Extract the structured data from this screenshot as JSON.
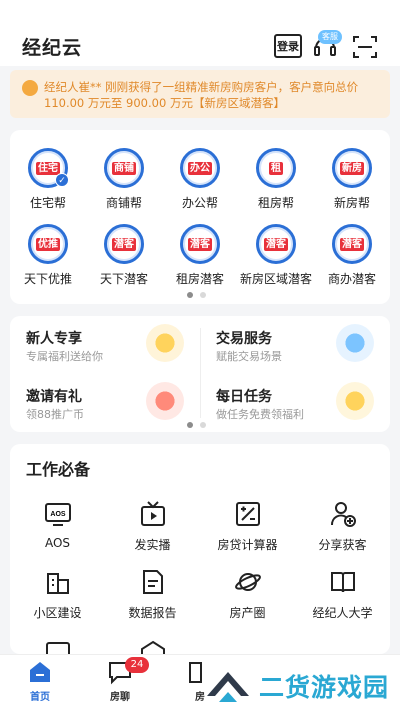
{
  "header": {
    "title": "经纪云",
    "login_label": "登录",
    "cs_badge": "客服",
    "icons": [
      "login-icon",
      "customer-service-icon",
      "scan-icon"
    ]
  },
  "notice": {
    "text_main": "经纪人崔** 刚刚获得了一组精准新房购房客户，客户意向总价 110.00 万元至 900.00 万元",
    "text_tag": "【新房区域潜客】"
  },
  "grid1": {
    "items": [
      {
        "logo": "住宅",
        "label": "住宅帮"
      },
      {
        "logo": "商铺",
        "label": "商铺帮"
      },
      {
        "logo": "办公",
        "label": "办公帮"
      },
      {
        "logo": "租",
        "label": "租房帮"
      },
      {
        "logo": "新房",
        "label": "新房帮"
      },
      {
        "logo": "优推",
        "label": "天下优推"
      },
      {
        "logo": "潜客",
        "label": "天下潜客"
      },
      {
        "logo": "潜客",
        "label": "租房潜客"
      },
      {
        "logo": "潜客",
        "label": "新房区域潜客"
      },
      {
        "logo": "潜客",
        "label": "商办潜客"
      }
    ]
  },
  "promo": {
    "items": [
      {
        "title": "新人专享",
        "sub": "专属福利送给你"
      },
      {
        "title": "交易服务",
        "sub": "赋能交易场景"
      },
      {
        "title": "邀请有礼",
        "sub": "领88推广币"
      },
      {
        "title": "每日任务",
        "sub": "做任务免费领福利"
      }
    ]
  },
  "work": {
    "title": "工作必备",
    "items": [
      {
        "label": "AOS",
        "icon": "aos-icon"
      },
      {
        "label": "发实播",
        "icon": "live-icon"
      },
      {
        "label": "房贷计算器",
        "icon": "calculator-icon"
      },
      {
        "label": "分享获客",
        "icon": "share-user-icon"
      },
      {
        "label": "小区建设",
        "icon": "building-icon"
      },
      {
        "label": "数据报告",
        "icon": "report-icon"
      },
      {
        "label": "房产圈",
        "icon": "planet-icon"
      },
      {
        "label": "经纪人大学",
        "icon": "book-icon"
      }
    ]
  },
  "tabbar": {
    "items": [
      {
        "label": "首页"
      },
      {
        "label": "房聊",
        "badge": "24"
      },
      {
        "label": "房"
      }
    ]
  },
  "watermark": {
    "text": "二货游戏园"
  },
  "colors": {
    "brand_blue": "#2b6fd6",
    "notice_orange": "#e0892a",
    "badge_red": "#e8313b"
  }
}
